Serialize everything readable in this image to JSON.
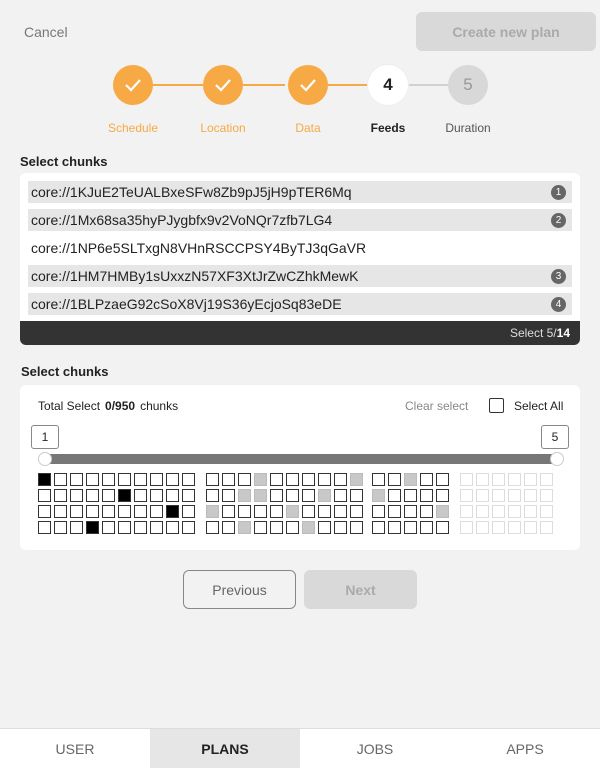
{
  "header": {
    "cancel_label": "Cancel",
    "create_label": "Create new plan"
  },
  "stepper": [
    {
      "label": "Schedule",
      "state": "done",
      "number": ""
    },
    {
      "label": "Location",
      "state": "done",
      "number": ""
    },
    {
      "label": "Data",
      "state": "done",
      "number": ""
    },
    {
      "label": "Feeds",
      "state": "active",
      "number": "4"
    },
    {
      "label": "Duration",
      "state": "todo",
      "number": "5"
    }
  ],
  "chunks_section": {
    "title": "Select chunks",
    "items": [
      {
        "text": "core://1KJuE2TeUALBxeSFw8Zb9pJ5jH9pTER6Mq",
        "selected": true,
        "badge": "1"
      },
      {
        "text": "core://1Mx68sa35hyPJygbfx9v2VoNQr7zfb7LG4",
        "selected": true,
        "badge": "2"
      },
      {
        "text": "core://1NP6e5SLTxgN8VHnRSCCPSY4ByTJ3qGaVR",
        "selected": false,
        "badge": ""
      },
      {
        "text": "core://1HM7HMBy1sUxxzN57XF3XtJrZwCZhkMewK",
        "selected": true,
        "badge": "3"
      },
      {
        "text": "core://1BLPzaeG92cSoX8Vj19S36yEcjoSq83eDE",
        "selected": true,
        "badge": "4"
      }
    ],
    "footer_prefix": "Select 5/",
    "footer_total": "14"
  },
  "grid_section": {
    "title": "Select chunks",
    "total_label": "Total Select",
    "total_value": "0/950",
    "total_unit": "chunks",
    "clear_label": "Clear select",
    "select_all_label": "Select All",
    "range_start": "1",
    "range_end": "5"
  },
  "nav": {
    "previous_label": "Previous",
    "next_label": "Next"
  },
  "tabs": [
    {
      "label": "USER",
      "active": false
    },
    {
      "label": "PLANS",
      "active": true
    },
    {
      "label": "JOBS",
      "active": false
    },
    {
      "label": "APPS",
      "active": false
    }
  ],
  "colors": {
    "accent": "#f7a945",
    "dark": "#333333",
    "disabled": "#d9d9d9"
  },
  "icons": {
    "done_step": "check-icon"
  }
}
